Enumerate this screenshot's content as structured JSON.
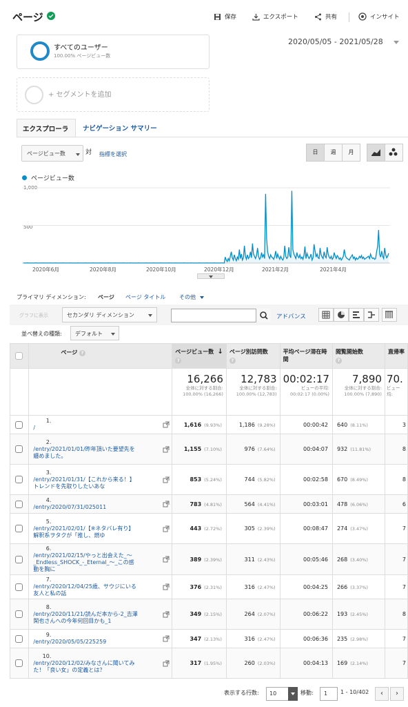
{
  "header": {
    "title": "ページ",
    "save": "保存",
    "export": "エクスポート",
    "share": "共有",
    "insight": "インサイト"
  },
  "segment": {
    "name": "すべてのユーザー",
    "sub": "100.00% ページビュー数",
    "add": "+ セグメントを追加"
  },
  "date_range": "2020/05/05 - 2021/05/28",
  "tabs": {
    "explorer": "エクスプローラ",
    "nav_summary": "ナビゲーション サマリー"
  },
  "chart_controls": {
    "metric": "ページビュー数",
    "vs": "対",
    "select_metric": "指標を選択",
    "day": "日",
    "week": "週",
    "month": "月"
  },
  "chart_data": {
    "type": "line",
    "series": [
      {
        "name": "ページビュー数",
        "color": "#058dc7"
      }
    ],
    "ylim": [
      0,
      1000
    ],
    "yticks": [
      "1,000",
      "500"
    ],
    "xticks": [
      "2020年6月",
      "2020年8月",
      "2020年10月",
      "2020年12月",
      "2021年2月",
      "2021年4月"
    ],
    "x_start": "2020-05-05",
    "x_end": "2021-05-28",
    "values": [
      1,
      1,
      0,
      1,
      2,
      1,
      1,
      0,
      1,
      1,
      0,
      1,
      2,
      1,
      1,
      0,
      1,
      1,
      0,
      2,
      1,
      1,
      0,
      1,
      1,
      0,
      2,
      1,
      1,
      0,
      1,
      1,
      2,
      1,
      0,
      1,
      1,
      0,
      1,
      2,
      1,
      1,
      0,
      1,
      1,
      0,
      2,
      1,
      1,
      0,
      1,
      1,
      0,
      1,
      2,
      1,
      1,
      0,
      1,
      1,
      0,
      2,
      1,
      1,
      0,
      1,
      1,
      0,
      1,
      2,
      1,
      1,
      0,
      1,
      1,
      0,
      2,
      1,
      1,
      0,
      1,
      1,
      0,
      1,
      2,
      1,
      1,
      0,
      1,
      1,
      0,
      2,
      1,
      1,
      0,
      1,
      1,
      0,
      1,
      2,
      1,
      1,
      0,
      1,
      1,
      0,
      2,
      1,
      1,
      0,
      1,
      1,
      0,
      1,
      2,
      1,
      1,
      0,
      1,
      1,
      0,
      2,
      1,
      1,
      0,
      1,
      1,
      0,
      1,
      2,
      1,
      1,
      0,
      1,
      1,
      0,
      2,
      1,
      1,
      0,
      1,
      1,
      0,
      1,
      2,
      1,
      1,
      0,
      1,
      1,
      0,
      2,
      1,
      1,
      0,
      1,
      1,
      0,
      1,
      2,
      1,
      1,
      0,
      1,
      1,
      0,
      2,
      1,
      1,
      0,
      1,
      1,
      0,
      1,
      2,
      1,
      1,
      0,
      1,
      1,
      0,
      2,
      1,
      1,
      0,
      1,
      1,
      0,
      1,
      2,
      1,
      1,
      0,
      1,
      1,
      0,
      2,
      1,
      1,
      0,
      80,
      40,
      20,
      60,
      30,
      90,
      150,
      70,
      40,
      110,
      60,
      30,
      80,
      50,
      180,
      60,
      120,
      40,
      70,
      230,
      90,
      50,
      110,
      60,
      80,
      150,
      70,
      260,
      120,
      90,
      60,
      100,
      200,
      90,
      50,
      70,
      140,
      80,
      110,
      60,
      920,
      320,
      150,
      90,
      60,
      110,
      80,
      70,
      50,
      90,
      160,
      60,
      120,
      80,
      50,
      90,
      60,
      40,
      70,
      230,
      90,
      60,
      80,
      210,
      100,
      70,
      960,
      180,
      120,
      90,
      60,
      140,
      90,
      70,
      110,
      60,
      80,
      50,
      100,
      220,
      60,
      130,
      90,
      60,
      80,
      120,
      40,
      70,
      250,
      160,
      80,
      120,
      70,
      60,
      200,
      110,
      80,
      60,
      150,
      90,
      70,
      210,
      120,
      80,
      60,
      90,
      50,
      70,
      140,
      90,
      60,
      100,
      80,
      50,
      70,
      40,
      60,
      90,
      180,
      100,
      70,
      60,
      50,
      40,
      70,
      90,
      110,
      60,
      80,
      40,
      70,
      50,
      60,
      90,
      70,
      100,
      60,
      80,
      50,
      60,
      70,
      80,
      90,
      60,
      120,
      80,
      60,
      70,
      50,
      60,
      150,
      220,
      440,
      120,
      80,
      160,
      90,
      60,
      200,
      110,
      70,
      90,
      130
    ]
  },
  "dims": {
    "label": "プライマリ ディメンション:",
    "page": "ページ",
    "page_title": "ページ タイトル",
    "other": "その他"
  },
  "toolbar": {
    "plot_rows": "グラフに表示",
    "secondary": "セカンダリ ディメンション",
    "advanced": "アドバンス",
    "sort_label": "並べ替えの種類:",
    "sort_value": "デフォルト"
  },
  "table": {
    "headers": [
      "ページ",
      "ページビュー数",
      "ページ別訪問数",
      "平均ページ滞在時間",
      "閲覧開始数",
      "直帰率"
    ],
    "totals": [
      {
        "value": "16,266",
        "sub": "全体に対する割合: 100.00% (16,266)"
      },
      {
        "value": "12,783",
        "sub": "全体に対する割合: 100.00% (12,783)"
      },
      {
        "value": "00:02:17",
        "sub": "ビューの平均: 00:02:17 (0.00%)"
      },
      {
        "value": "7,890",
        "sub": "全体に対する割合: 100.00% (7,890)"
      },
      {
        "value": "70.",
        "sub": "ビュー 均:"
      }
    ],
    "rows": [
      {
        "idx": "1.",
        "page": "/",
        "pv": "1,616",
        "pv_pct": "(9.93%)",
        "upv": "1,186",
        "upv_pct": "(9.28%)",
        "time": "00:00:42",
        "ent": "640",
        "ent_pct": "(8.11%)",
        "last": "3"
      },
      {
        "idx": "2.",
        "page": "/entry/2021/01/01/昨年頂いた要望先を纏めました。",
        "pv": "1,155",
        "pv_pct": "(7.10%)",
        "upv": "976",
        "upv_pct": "(7.64%)",
        "time": "00:04:07",
        "ent": "932",
        "ent_pct": "(11.81%)",
        "last": "8"
      },
      {
        "idx": "3.",
        "page": "/entry/2021/01/31/【これから来る！】トレンドを先取りしたいあな",
        "pv": "853",
        "pv_pct": "(5.24%)",
        "upv": "744",
        "upv_pct": "(5.82%)",
        "time": "00:02:58",
        "ent": "670",
        "ent_pct": "(8.49%)",
        "last": "8"
      },
      {
        "idx": "4.",
        "page": "/entry/2020/07/31/025011",
        "pv": "783",
        "pv_pct": "(4.81%)",
        "upv": "564",
        "upv_pct": "(4.41%)",
        "time": "00:03:01",
        "ent": "478",
        "ent_pct": "(6.06%)",
        "last": "6"
      },
      {
        "idx": "5.",
        "page": "/entry/2021/02/01/【※ネタバレ有り】解釈系ヲタクが「推し、燃ゆ",
        "pv": "443",
        "pv_pct": "(2.72%)",
        "upv": "305",
        "upv_pct": "(2.39%)",
        "time": "00:08:47",
        "ent": "274",
        "ent_pct": "(3.47%)",
        "last": "7"
      },
      {
        "idx": "6.",
        "page": "/entry/2021/02/15/やっと出会えた_〜_Endless_SHOCK_-_Eternal_〜_この感動を胸に",
        "pv": "389",
        "pv_pct": "(2.39%)",
        "upv": "311",
        "upv_pct": "(2.43%)",
        "time": "00:05:46",
        "ent": "268",
        "ent_pct": "(3.40%)",
        "last": "7"
      },
      {
        "idx": "7.",
        "page": "/entry/2020/12/04/25歳、サウジにいる友人と私の話",
        "pv": "376",
        "pv_pct": "(2.31%)",
        "upv": "316",
        "upv_pct": "(2.47%)",
        "time": "00:04:25",
        "ent": "266",
        "ent_pct": "(3.37%)",
        "last": "7"
      },
      {
        "idx": "8.",
        "page": "/entry/2020/11/21/読んだ本から-2_吉澤閑也さんへの今年何回目かも_1",
        "pv": "349",
        "pv_pct": "(2.15%)",
        "upv": "264",
        "upv_pct": "(2.07%)",
        "time": "00:06:22",
        "ent": "193",
        "ent_pct": "(2.45%)",
        "last": "8"
      },
      {
        "idx": "9.",
        "page": "/entry/2020/05/05/225259",
        "pv": "347",
        "pv_pct": "(2.13%)",
        "upv": "316",
        "upv_pct": "(2.47%)",
        "time": "00:06:36",
        "ent": "235",
        "ent_pct": "(2.98%)",
        "last": "7"
      },
      {
        "idx": "10.",
        "page": "/entry/2020/12/02/みなさんに聞いてみた！「良い女」の定義とは？",
        "pv": "317",
        "pv_pct": "(1.95%)",
        "upv": "260",
        "upv_pct": "(2.03%)",
        "time": "00:04:13",
        "ent": "169",
        "ent_pct": "(2.14%)",
        "last": "7"
      }
    ]
  },
  "footer": {
    "rows_label": "表示する行数:",
    "rows_value": "10",
    "goto_label": "移動:",
    "goto_value": "1",
    "range": "1 - 10/402"
  }
}
